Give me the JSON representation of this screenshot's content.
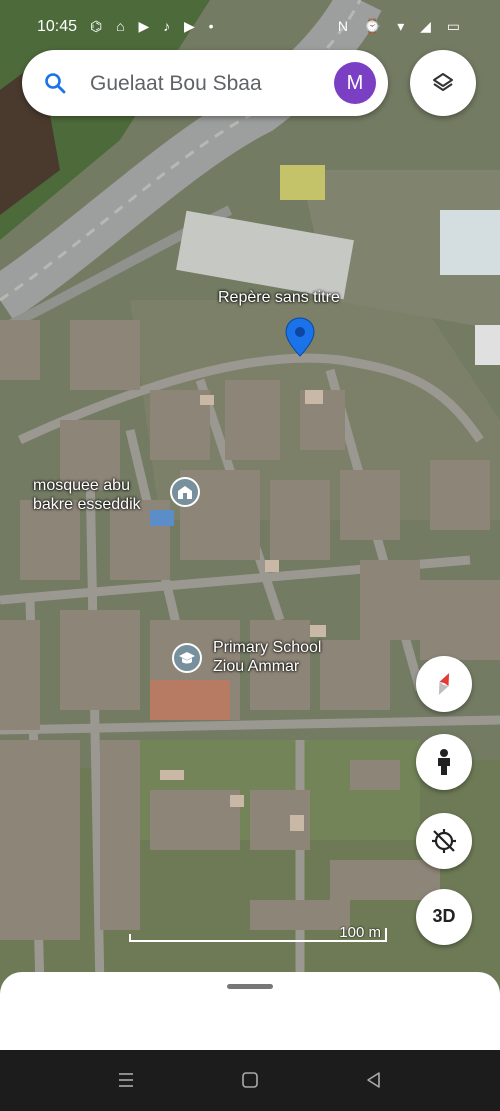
{
  "status_bar": {
    "time": "10:45",
    "left_icons": "⌬ ⌂ ▶ ♪ ▶ •",
    "right_icons": "N ⌚ ▾ ◢ ▭"
  },
  "search": {
    "value": "Guelaat Bou Sbaa",
    "avatar_letter": "M"
  },
  "map": {
    "pin_label": "Repère sans titre",
    "places": [
      {
        "name": "mosquee abu bakre esseddik",
        "line1": "mosquee abu",
        "line2": "bakre esseddik",
        "icon": "mosque-icon"
      },
      {
        "name": "Primary School Ziou Ammar",
        "line1": "Primary School",
        "line2": "Ziou Ammar",
        "icon": "school-icon"
      }
    ],
    "scale_label": "100 m"
  },
  "controls": {
    "three_d_label": "3D"
  },
  "colors": {
    "pin": "#1a73e8",
    "avatar": "#7b3fc4",
    "poi": "#78909c"
  }
}
